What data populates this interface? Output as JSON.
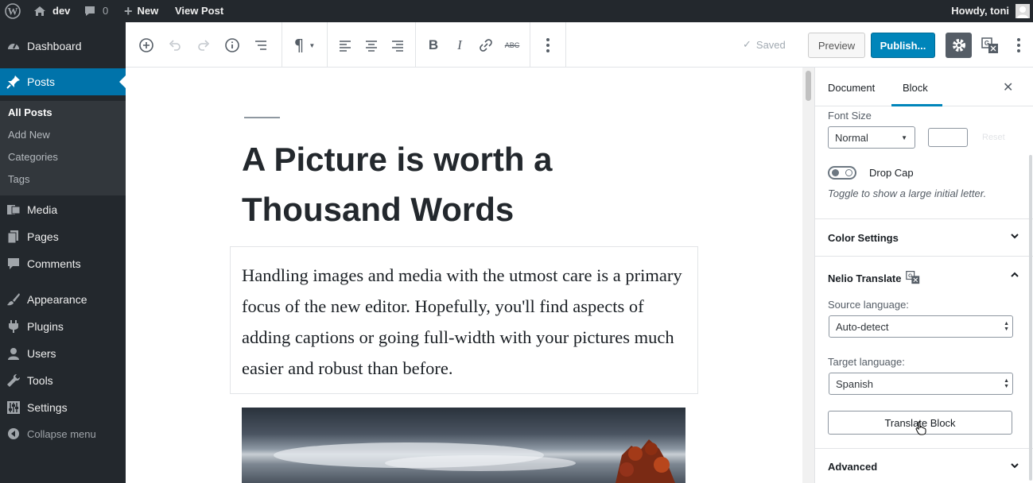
{
  "adminbar": {
    "site_name": "dev",
    "comments_count": "0",
    "new_label": "New",
    "view_post_label": "View Post",
    "howdy_label": "Howdy, toni"
  },
  "sidebar": {
    "items": [
      {
        "label": "Dashboard",
        "icon": "dashboard-icon"
      },
      {
        "label": "Posts",
        "icon": "pin-icon"
      },
      {
        "label": "Media",
        "icon": "media-icon"
      },
      {
        "label": "Pages",
        "icon": "pages-icon"
      },
      {
        "label": "Comments",
        "icon": "comment-icon"
      },
      {
        "label": "Appearance",
        "icon": "paintbrush-icon"
      },
      {
        "label": "Plugins",
        "icon": "plug-icon"
      },
      {
        "label": "Users",
        "icon": "user-icon"
      },
      {
        "label": "Tools",
        "icon": "wrench-icon"
      },
      {
        "label": "Settings",
        "icon": "sliders-icon"
      }
    ],
    "submenu": [
      "All Posts",
      "Add New",
      "Categories",
      "Tags"
    ],
    "collapse_label": "Collapse menu"
  },
  "toolbar": {
    "saved_label": "Saved",
    "preview_label": "Preview",
    "publish_label": "Publish..."
  },
  "post": {
    "title_line1": "A Picture is worth a",
    "title_line2": "Thousand Words",
    "paragraph_lines": [
      "Handling images and media with the utmost care is a primary",
      "focus of the new editor. Hopefully, you'll find aspects of",
      "adding captions or going full-width with your pictures much",
      "easier and robust than before."
    ]
  },
  "panel": {
    "tabs": [
      "Document",
      "Block"
    ],
    "active_tab": "Block",
    "font_size_label": "Font Size",
    "font_size_value": "Normal",
    "reset_label": "Reset",
    "drop_cap_label": "Drop Cap",
    "drop_cap_help": "Toggle to show a large initial letter.",
    "color_settings_label": "Color Settings",
    "nelio_label": "Nelio Translate",
    "source_language_label": "Source language:",
    "source_language_value": "Auto-detect",
    "target_language_label": "Target language:",
    "target_language_value": "Spanish",
    "translate_button_label": "Translate Block",
    "advanced_label": "Advanced"
  },
  "colors": {
    "admin_dark": "#23282d",
    "admin_sub": "#32373c",
    "accent": "#0073aa",
    "publish": "#0085ba"
  }
}
